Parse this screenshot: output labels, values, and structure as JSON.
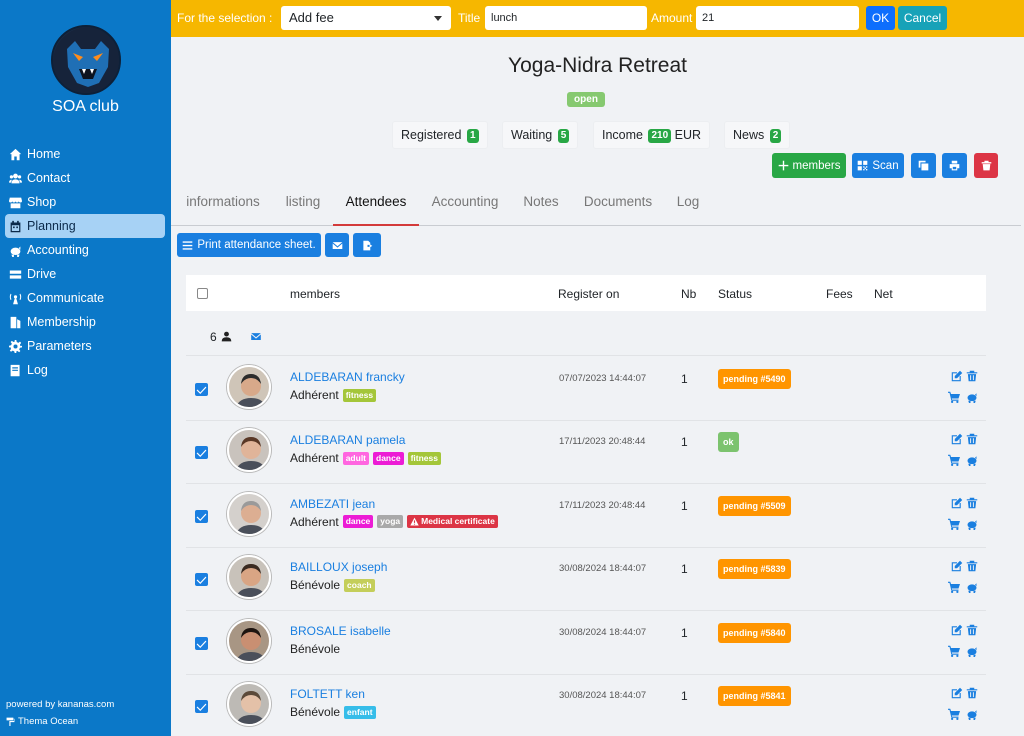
{
  "sidebar": {
    "club_name": "SOA club",
    "items": [
      {
        "label": "Home",
        "icon": "home-icon"
      },
      {
        "label": "Contact",
        "icon": "users-icon"
      },
      {
        "label": "Shop",
        "icon": "store-icon"
      },
      {
        "label": "Planning",
        "icon": "calendar-icon",
        "active": true
      },
      {
        "label": "Accounting",
        "icon": "piggy-bank-icon"
      },
      {
        "label": "Drive",
        "icon": "drive-icon"
      },
      {
        "label": "Communicate",
        "icon": "broadcast-icon"
      },
      {
        "label": "Membership",
        "icon": "membership-icon"
      },
      {
        "label": "Parameters",
        "icon": "gear-icon"
      },
      {
        "label": "Log",
        "icon": "book-icon"
      }
    ],
    "powered_by": "powered by kananas.com",
    "theme": "Thema Ocean"
  },
  "topbar": {
    "selection_label": "For the selection :",
    "action_value": "Add fee",
    "title_label": "Title",
    "title_value": "lunch",
    "amount_label": "Amount",
    "amount_value": "21",
    "ok_label": "OK",
    "cancel_label": "Cancel"
  },
  "event": {
    "title": "Yoga-Nidra Retreat",
    "status": "open",
    "stats": [
      {
        "label": "Registered",
        "count": "1"
      },
      {
        "label": "Waiting",
        "count": "5"
      },
      {
        "label": "Income",
        "count": "210",
        "suffix": "EUR"
      },
      {
        "label": "News",
        "count": "2"
      }
    ],
    "add_members_label": "members",
    "scan_label": "Scan"
  },
  "tabs": [
    "informations",
    "listing",
    "Attendees",
    "Accounting",
    "Notes",
    "Documents",
    "Log"
  ],
  "print_sheet_label": "Print attendance sheet.",
  "table": {
    "headers": {
      "members": "members",
      "register_on": "Register on",
      "nb": "Nb",
      "status": "Status",
      "fees": "Fees",
      "net": "Net"
    },
    "count": "6",
    "rows": [
      {
        "name": "ALDEBARAN francky",
        "role": "Adhérent",
        "tags": [
          {
            "text": "fitness",
            "color": "#a4c639"
          }
        ],
        "date": "07/07/2023 14:44:07",
        "nb": "1",
        "status": "pending #5490",
        "status_color": "#ff9500"
      },
      {
        "name": "ALDEBARAN pamela",
        "role": "Adhérent",
        "tags": [
          {
            "text": "adult",
            "color": "#ff66e0"
          },
          {
            "text": "dance",
            "color": "#ec1cd5"
          },
          {
            "text": "fitness",
            "color": "#a4c639"
          }
        ],
        "date": "17/11/2023 20:48:44",
        "nb": "1",
        "status": "ok",
        "status_color": "#7cc36e"
      },
      {
        "name": "AMBEZATI jean",
        "role": "Adhérent",
        "tags": [
          {
            "text": "dance",
            "color": "#ec1cd5"
          },
          {
            "text": "yoga",
            "color": "#a9a9a9"
          },
          {
            "text": "Medical certificate",
            "color": "#dc3545",
            "icon": "warning-icon"
          }
        ],
        "date": "17/11/2023 20:48:44",
        "nb": "1",
        "status": "pending #5509",
        "status_color": "#ff9500"
      },
      {
        "name": "BAILLOUX joseph",
        "role": "Bénévole",
        "tags": [
          {
            "text": "coach",
            "color": "#c4ce5a"
          }
        ],
        "date": "30/08/2024 18:44:07",
        "nb": "1",
        "status": "pending #5839",
        "status_color": "#ff9500"
      },
      {
        "name": "BROSALE isabelle",
        "role": "Bénévole",
        "tags": [],
        "date": "30/08/2024 18:44:07",
        "nb": "1",
        "status": "pending #5840",
        "status_color": "#ff9500"
      },
      {
        "name": "FOLTETT ken",
        "role": "Bénévole",
        "tags": [
          {
            "text": "enfant",
            "color": "#36bde9"
          }
        ],
        "date": "30/08/2024 18:44:07",
        "nb": "1",
        "status": "pending #5841",
        "status_color": "#ff9500"
      }
    ]
  }
}
